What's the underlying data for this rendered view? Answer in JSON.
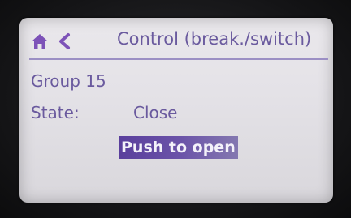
{
  "header": {
    "home_icon": "home-icon",
    "back_icon": "chevron-left-icon",
    "title": "Control (break./switch)"
  },
  "main": {
    "group_label": "Group 15",
    "state_label": "State:",
    "state_value": "Close",
    "action_button_label": "Push to open"
  },
  "colors": {
    "accent": "#6a5a9e",
    "button_bg": "#5a3f9c",
    "screen_bg": "#e4e2e7"
  }
}
